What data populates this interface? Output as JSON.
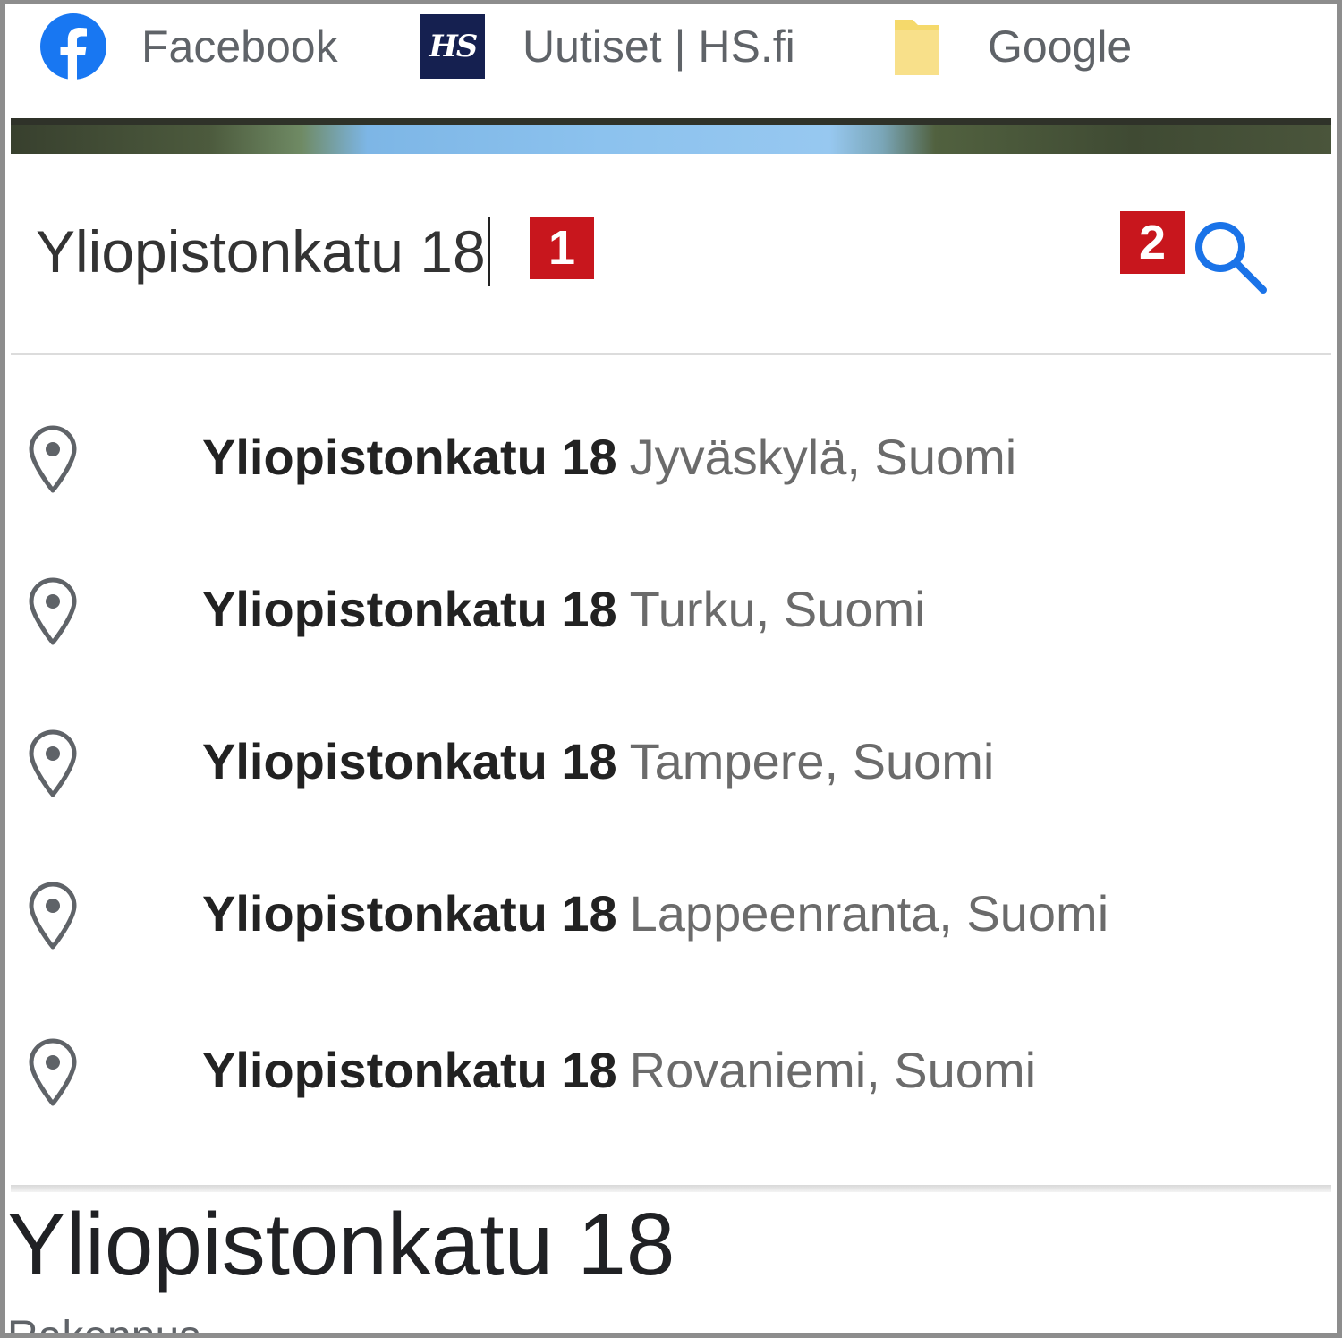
{
  "bookmarks": [
    {
      "label": "Facebook",
      "icon": "facebook-icon"
    },
    {
      "label": "Uutiset | HS.fi",
      "icon": "hs-icon",
      "icon_text": "HS"
    },
    {
      "label": "Google",
      "icon": "folder-icon"
    }
  ],
  "search": {
    "value": "Yliopistonkatu 18",
    "icon": "search-icon",
    "badge_1": "1",
    "badge_2": "2"
  },
  "suggestions": [
    {
      "main": "Yliopistonkatu 18",
      "secondary": "Jyväskylä, Suomi"
    },
    {
      "main": "Yliopistonkatu 18",
      "secondary": "Turku, Suomi"
    },
    {
      "main": "Yliopistonkatu 18",
      "secondary": "Tampere, Suomi"
    },
    {
      "main": "Yliopistonkatu 18",
      "secondary": "Lappeenranta, Suomi"
    },
    {
      "main": "Yliopistonkatu 18",
      "secondary": "Rovaniemi, Suomi"
    }
  ],
  "result": {
    "title": "Yliopistonkatu 18",
    "subtitle": "Rakennus"
  },
  "colors": {
    "facebook": "#1877f2",
    "hs": "#152050",
    "folder": "#f5d96b",
    "badge": "#c8161d",
    "search_icon": "#1a73e8"
  }
}
